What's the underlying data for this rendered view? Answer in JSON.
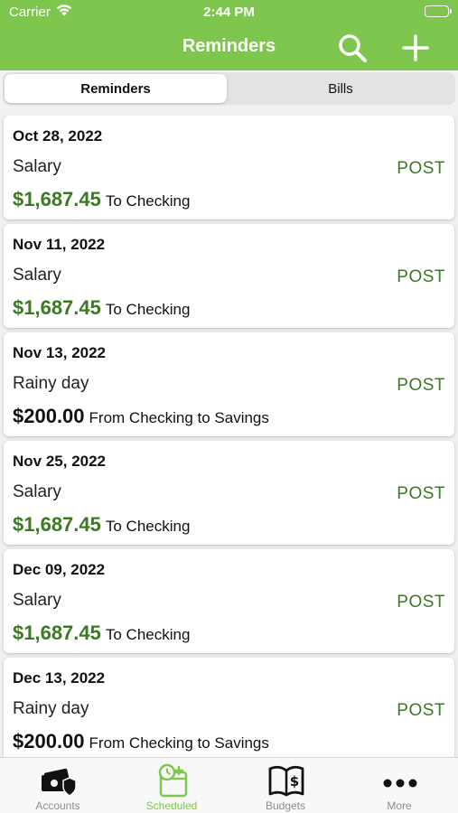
{
  "status_bar": {
    "carrier": "Carrier",
    "time": "2:44 PM"
  },
  "nav": {
    "title": "Reminders"
  },
  "segments": {
    "left": "Reminders",
    "right": "Bills",
    "selected": "Reminders"
  },
  "reminders": [
    {
      "date": "Oct 28, 2022",
      "name": "Salary",
      "amount": "$1,687.45",
      "description": "To Checking",
      "action": "POST",
      "amount_color": "#3a7b22"
    },
    {
      "date": "Nov 11, 2022",
      "name": "Salary",
      "amount": "$1,687.45",
      "description": "To Checking",
      "action": "POST",
      "amount_color": "#3a7b22"
    },
    {
      "date": "Nov 13, 2022",
      "name": "Rainy day",
      "amount": "$200.00",
      "description": "From Checking to Savings",
      "action": "POST",
      "amount_color": "#111111"
    },
    {
      "date": "Nov 25, 2022",
      "name": "Salary",
      "amount": "$1,687.45",
      "description": "To Checking",
      "action": "POST",
      "amount_color": "#3a7b22"
    },
    {
      "date": "Dec 09, 2022",
      "name": "Salary",
      "amount": "$1,687.45",
      "description": "To Checking",
      "action": "POST",
      "amount_color": "#3a7b22"
    },
    {
      "date": "Dec 13, 2022",
      "name": "Rainy day",
      "amount": "$200.00",
      "description": "From Checking to Savings",
      "action": "POST",
      "amount_color": "#111111"
    }
  ],
  "tab_bar": {
    "tabs": [
      {
        "label": "Accounts",
        "icon": "accounts-icon"
      },
      {
        "label": "Scheduled",
        "icon": "scheduled-icon",
        "active": true
      },
      {
        "label": "Budgets",
        "icon": "budgets-icon"
      },
      {
        "label": "More",
        "icon": "more-icon"
      }
    ]
  },
  "colors": {
    "brand_green": "#7fc64f",
    "amount_green": "#3a7b22",
    "inactive_tab": "#8e8e93"
  }
}
